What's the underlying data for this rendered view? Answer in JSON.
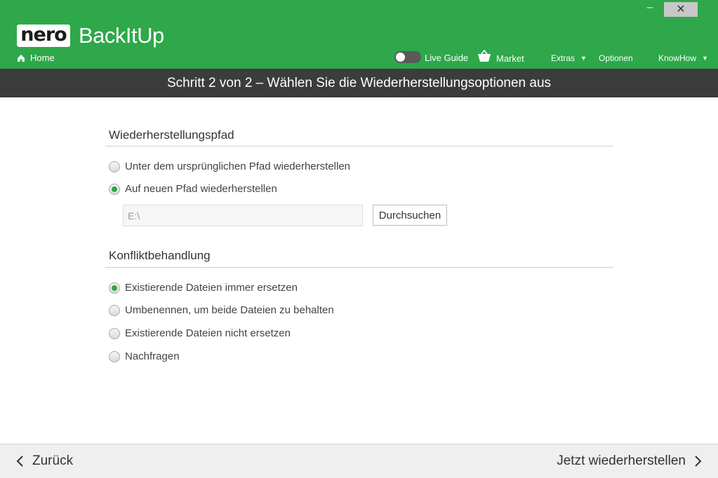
{
  "window": {
    "minimize_glyph": "–",
    "close_glyph": "✕"
  },
  "header": {
    "logo_text": "nero",
    "app_title": "BackItUp",
    "home_label": "Home",
    "live_guide_label": "Live Guide",
    "market_label": "Market",
    "extras_label": "Extras",
    "optionen_label": "Optionen",
    "knowhow_label": "KnowHow",
    "accent_color": "#2ea84a"
  },
  "step": {
    "title": "Schritt 2 von 2 – Wählen Sie die Wiederherstellungsoptionen aus"
  },
  "restore_path": {
    "title": "Wiederherstellungspfad",
    "options": [
      {
        "label": "Unter dem ursprünglichen Pfad wiederherstellen",
        "checked": false
      },
      {
        "label": "Auf neuen Pfad wiederherstellen",
        "checked": true
      }
    ],
    "path_value": "E:\\",
    "browse_label": "Durchsuchen"
  },
  "conflict": {
    "title": "Konfliktbehandlung",
    "options": [
      {
        "label": "Existierende Dateien immer ersetzen",
        "checked": true
      },
      {
        "label": "Umbenennen, um beide Dateien zu behalten",
        "checked": false
      },
      {
        "label": "Existierende Dateien nicht ersetzen",
        "checked": false
      },
      {
        "label": "Nachfragen",
        "checked": false
      }
    ]
  },
  "footer": {
    "back_label": "Zurück",
    "next_label": "Jetzt wiederherstellen"
  }
}
